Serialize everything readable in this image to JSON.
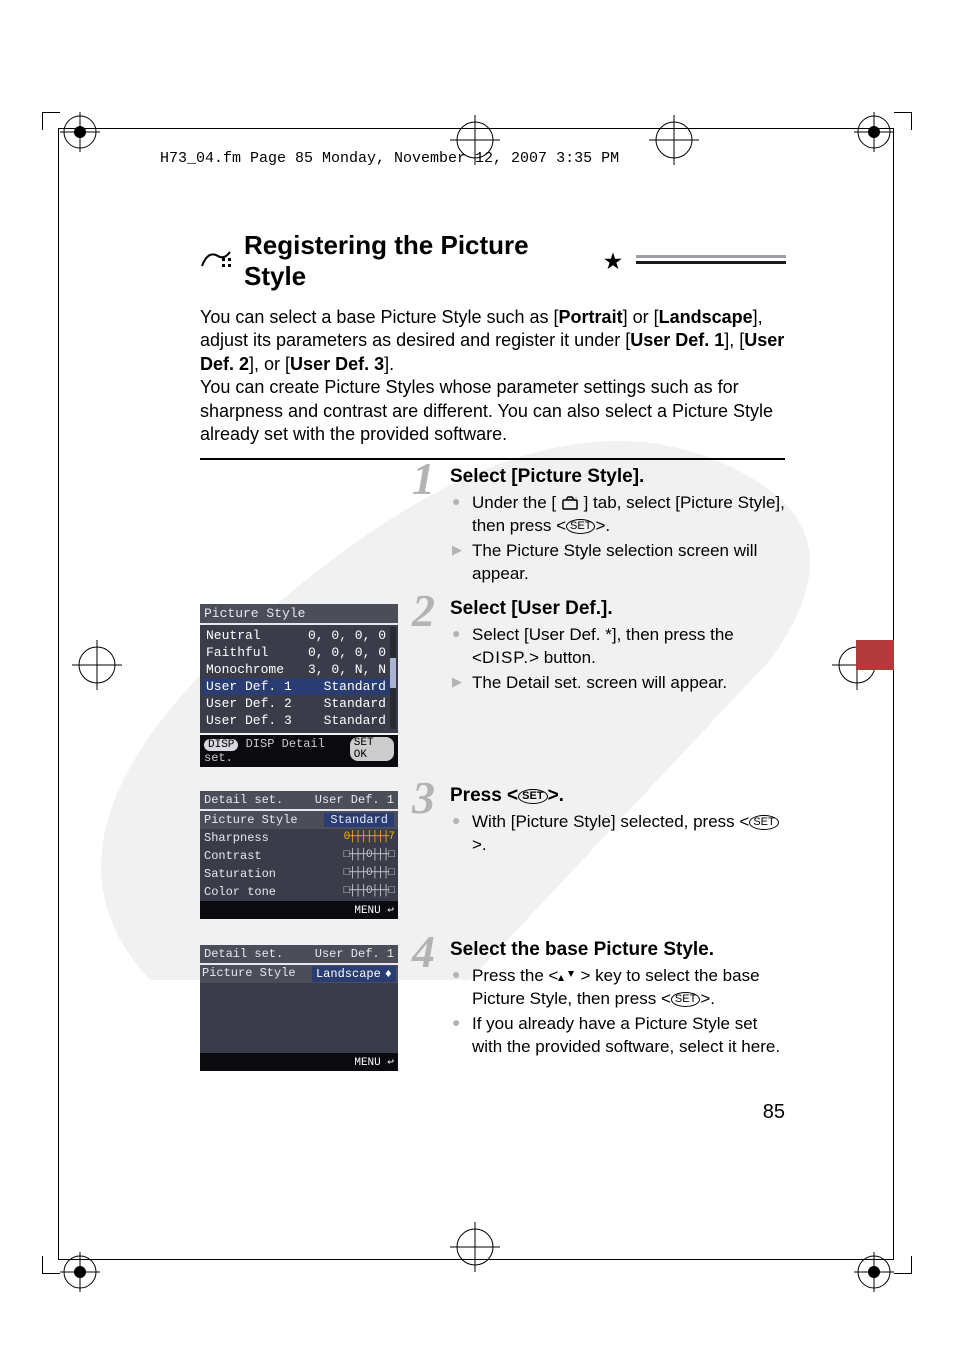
{
  "header_line": "H73_04.fm  Page 85  Monday, November 12, 2007  3:35 PM",
  "title_prefix_icon": "picture-style-icon",
  "title_text": "Registering the Picture Style",
  "title_star": "★",
  "intro_line1a": "You can select a base Picture Style such as [",
  "intro_line1b": "Portrait",
  "intro_line1c": "] or [",
  "intro_line1d": "Landscape",
  "intro_line1e": "], adjust its parameters as desired and register it under [",
  "intro_line1f": "User Def. 1",
  "intro_line1g": "], [",
  "intro_line1h": "User Def. 2",
  "intro_line1i": "], or [",
  "intro_line1j": "User Def. 3",
  "intro_line1k": "].",
  "intro_line2": "You can create Picture Styles whose parameter settings such as for sharpness and contrast are different. You can also select a Picture Style already set with the provided software.",
  "steps": {
    "s1": {
      "num": "1",
      "title": "Select [Picture Style].",
      "b1a": "Under the [",
      "b1b": "] tab, select [",
      "b1c": "Picture Style",
      "b1d": "], then press <",
      "b1e": ">.",
      "t1": "The Picture Style selection screen will appear."
    },
    "s2": {
      "num": "2",
      "title": "Select [User Def.].",
      "b1a": "Select [",
      "b1b": "User Def. *",
      "b1c": "], then press the <",
      "b1d": "DISP.",
      "b1e": "> button.",
      "t1": "The Detail set. screen will appear."
    },
    "s3": {
      "num": "3",
      "title_a": "Press <",
      "title_b": ">.",
      "b1a": "With [",
      "b1b": "Picture Style",
      "b1c": "] selected, press <",
      "b1d": ">."
    },
    "s4": {
      "num": "4",
      "title": "Select the base Picture Style.",
      "b1a": "Press the <",
      "b1b": "> key to select the base Picture Style, then press <",
      "b1c": ">.",
      "b2": "If you already have a Picture Style set with the provided software, select it here."
    }
  },
  "lcd1": {
    "title": "Picture Style",
    "rows": [
      {
        "l": "Neutral",
        "r": "0, 0, 0, 0"
      },
      {
        "l": "Faithful",
        "r": "0, 0, 0, 0"
      },
      {
        "l": "Monochrome",
        "r": "3, 0, N, N"
      },
      {
        "l": "User Def. 1",
        "r": "Standard",
        "sel": true
      },
      {
        "l": "User Def. 2",
        "r": "Standard"
      },
      {
        "l": "User Def. 3",
        "r": "Standard"
      }
    ],
    "footer_left": "DISP Detail set.",
    "footer_right": "SET OK"
  },
  "lcd2": {
    "hdr_l": "Detail set.",
    "hdr_r": "User Def. 1",
    "row_ps_l": "Picture Style",
    "row_ps_r": "Standard",
    "rows": [
      {
        "l": "Sharpness",
        "slider": "0┼┼┼┼┼┼┼7"
      },
      {
        "l": "Contrast",
        "slider": "□┼┼┼0┼┼┼□"
      },
      {
        "l": "Saturation",
        "slider": "□┼┼┼0┼┼┼□"
      },
      {
        "l": "Color tone",
        "slider": "□┼┼┼0┼┼┼□"
      }
    ],
    "footer": "MENU ↩"
  },
  "lcd3": {
    "hdr_l": "Detail set.",
    "hdr_r": "User Def. 1",
    "row_ps_l": "Picture Style",
    "row_ps_r": "Landscape",
    "footer": "MENU ↩"
  },
  "page_num": "85",
  "set_label": "SET",
  "disp_label": "DISP"
}
